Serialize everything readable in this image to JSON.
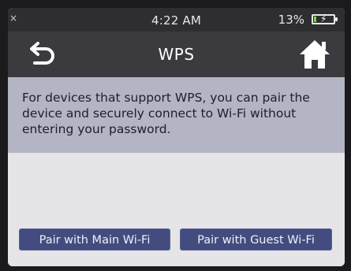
{
  "status_bar": {
    "close_glyph": "×",
    "time": "4:22 AM",
    "battery_percent": "13%",
    "battery_level": 0.13,
    "battery_color": "#6fdb3a"
  },
  "header": {
    "title": "WPS",
    "back_icon": "back-arrow-icon",
    "home_icon": "home-icon"
  },
  "info": {
    "text": "For devices that support WPS, you can pair the device and securely connect to Wi-Fi without entering your password."
  },
  "actions": {
    "main_label": "Pair with Main Wi-Fi",
    "guest_label": "Pair with Guest Wi-Fi",
    "button_color": "#444c7f"
  }
}
